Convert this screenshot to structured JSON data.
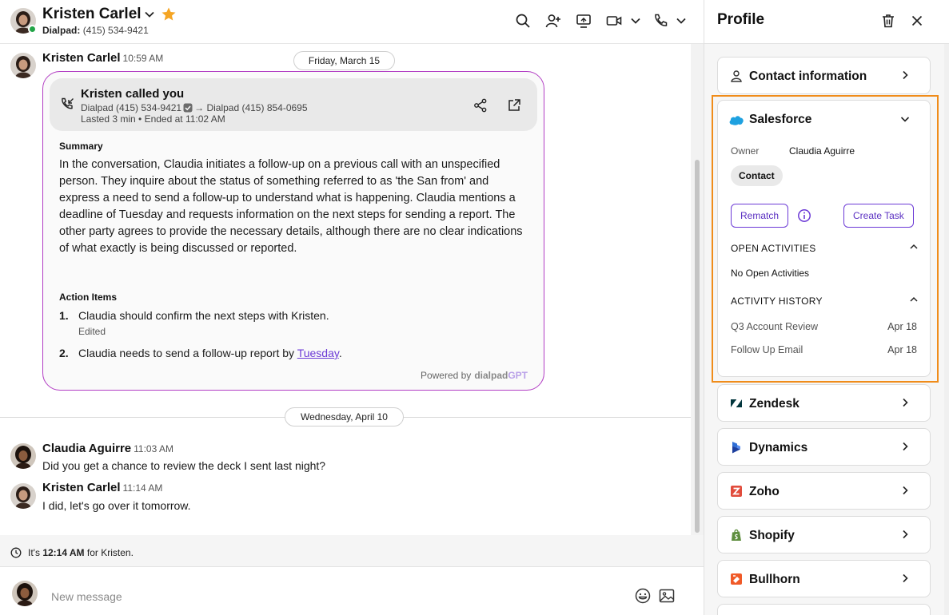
{
  "contact": {
    "name": "Kristen Carlel",
    "line_label": "Dialpad:",
    "line_number": "(415) 534-9421"
  },
  "date_pills": [
    "Friday, March 15",
    "Wednesday, April 10"
  ],
  "call_message": {
    "sender": "Kristen Carlel",
    "time": "10:59 AM",
    "recap": {
      "title": "Kristen called you",
      "from": "Dialpad (415) 534-9421",
      "to": "Dialpad (415) 854-0695",
      "duration": "Lasted 3 min • Ended at 11:02 AM",
      "summary_heading": "Summary",
      "summary": "In the conversation, Claudia initiates a follow-up on a previous call with an unspecified person. They inquire about the status of something referred to as 'the San from' and express a need to send a follow-up to understand what is happening. Claudia mentions a deadline of Tuesday and requests information on the next steps for sending a report. The other party agrees to provide the necessary details, although there are no clear indications of what exactly is being discussed or reported.",
      "action_heading": "Action Items",
      "items": [
        {
          "num": "1.",
          "text": "Claudia should confirm the next steps with Kristen.",
          "note": "Edited"
        },
        {
          "num": "2.",
          "text": "Claudia needs to send a follow-up report by ",
          "link": "Tuesday",
          "tail": "."
        }
      ],
      "powered_label": "Powered by",
      "brand": "dialpad",
      "brand_suffix": "GPT"
    }
  },
  "messages": [
    {
      "sender": "Claudia Aguirre",
      "time": "11:03 AM",
      "text": "Did you get a chance to review the deck I sent last night?"
    },
    {
      "sender": "Kristen Carlel",
      "time": "11:14 AM",
      "text": "I did, let's go over it tomorrow."
    }
  ],
  "status": {
    "prefix": "It's",
    "time": "12:14 AM",
    "suffix": "for Kristen."
  },
  "composer": {
    "placeholder": "New message"
  },
  "panel": {
    "title": "Profile",
    "contact_info": "Contact information",
    "salesforce": {
      "title": "Salesforce",
      "owner_label": "Owner",
      "owner_value": "Claudia Aguirre",
      "chip": "Contact",
      "rematch": "Rematch",
      "create_task": "Create Task",
      "open_heading": "OPEN ACTIVITIES",
      "open_empty": "No Open Activities",
      "history_heading": "ACTIVITY HISTORY",
      "history": [
        {
          "label": "Q3 Account Review",
          "date": "Apr 18"
        },
        {
          "label": "Follow Up Email",
          "date": "Apr 18"
        }
      ]
    },
    "integrations": [
      "Zendesk",
      "Dynamics",
      "Zoho",
      "Shopify",
      "Bullhorn"
    ]
  },
  "colors": {
    "accent": "#6c3ad6",
    "ai_border": "#b23dc4",
    "highlight": "#f08c1a",
    "presence": "#22a447",
    "star": "#f5a524"
  }
}
